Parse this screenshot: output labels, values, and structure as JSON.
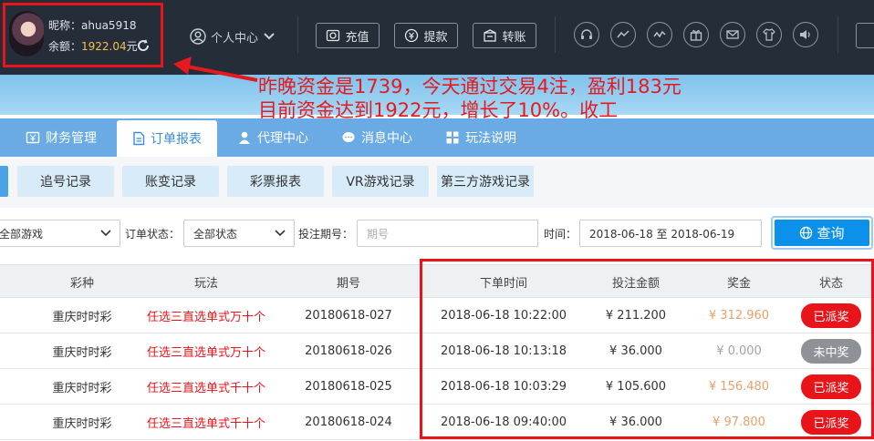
{
  "user": {
    "nickname_label": "昵称：",
    "nickname": "ahua5918",
    "balance_label": "余额：",
    "balance": "1922.04",
    "balance_unit": "元"
  },
  "header": {
    "personal_center": "个人中心",
    "buttons": [
      {
        "label": "充值",
        "icon": "deposit-icon"
      },
      {
        "label": "提款",
        "icon": "withdraw-icon"
      },
      {
        "label": "转账",
        "icon": "transfer-icon"
      }
    ],
    "round_icons": [
      "headset-icon",
      "trend-icon",
      "chart-icon",
      "gift-icon",
      "mail-icon",
      "shirt-icon",
      "speaker-icon"
    ]
  },
  "annotation": {
    "line1": "昨晚资金是1739，今天通过交易4注，盈利183元",
    "line2": "目前资金达到1922元，增长了10%。收工"
  },
  "nav": [
    {
      "label": "财务管理",
      "icon": "finance-icon"
    },
    {
      "label": "订单报表",
      "icon": "report-icon"
    },
    {
      "label": "代理中心",
      "icon": "agent-icon"
    },
    {
      "label": "消息中心",
      "icon": "message-icon"
    },
    {
      "label": "玩法说明",
      "icon": "rules-icon"
    }
  ],
  "subtabs": [
    "追号记录",
    "账变记录",
    "彩票报表",
    "VR游戏记录",
    "第三方游戏记录"
  ],
  "filter": {
    "game_select": "全部游戏",
    "status_label": "订单状态：",
    "status_select": "全部状态",
    "period_label": "投注期号：",
    "period_placeholder": "期号",
    "time_label": "时间：",
    "time_range": "2018-06-18 至 2018-06-19",
    "query_label": "查询"
  },
  "table": {
    "headers": [
      "彩种",
      "玩法",
      "期号",
      "下单时间",
      "投注金额",
      "奖金",
      "状态"
    ],
    "rows": [
      {
        "lottery": "重庆时时彩",
        "play": "任选三直选单式万十个",
        "period": "20180618-027",
        "time": "2018-06-18 10:22:00",
        "amount": "¥ 211.200",
        "prize": "¥ 312.960",
        "status": "已派奖",
        "won": true
      },
      {
        "lottery": "重庆时时彩",
        "play": "任选三直选单式万十个",
        "period": "20180618-026",
        "time": "2018-06-18 10:13:18",
        "amount": "¥ 36.000",
        "prize": "¥ 0.000",
        "status": "未中奖",
        "won": false
      },
      {
        "lottery": "重庆时时彩",
        "play": "任选三直选单式千十个",
        "period": "20180618-025",
        "time": "2018-06-18 10:03:29",
        "amount": "¥ 105.600",
        "prize": "¥ 156.480",
        "status": "已派奖",
        "won": true
      },
      {
        "lottery": "重庆时时彩",
        "play": "任选三直选单式千十个",
        "period": "20180618-024",
        "time": "2018-06-18 09:40:00",
        "amount": "¥ 36.000",
        "prize": "¥ 97.800",
        "status": "已派奖",
        "won": true
      }
    ]
  },
  "colors": {
    "topbar": "#242d38",
    "nav": "#6aabe6",
    "accent": "#0c91ea",
    "annotation_red": "#e5191e",
    "balance_gold": "#f4c04a"
  }
}
